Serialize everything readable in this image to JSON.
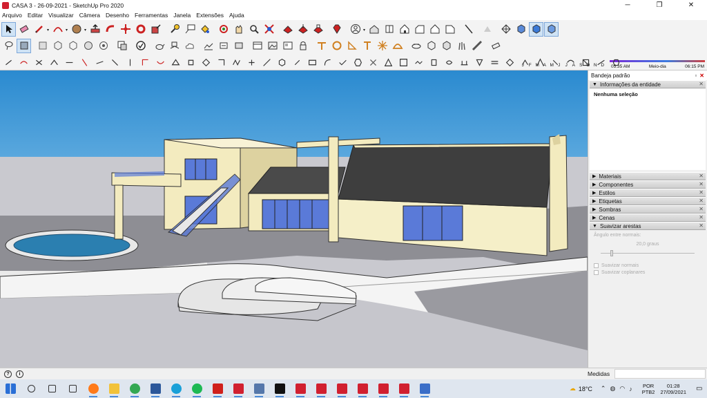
{
  "window": {
    "title": "CASA 3 - 26-09-2021 - SketchUp Pro 2020",
    "minimize": "─",
    "maximize": "❐",
    "close": "✕"
  },
  "menu": [
    "Arquivo",
    "Editar",
    "Visualizar",
    "Câmera",
    "Desenho",
    "Ferramentas",
    "Janela",
    "Extensões",
    "Ajuda"
  ],
  "shadow": {
    "months": [
      "J",
      "F",
      "M",
      "A",
      "M",
      "J",
      "J",
      "A",
      "S",
      "O",
      "N",
      "D"
    ],
    "time_start": "05:35 AM",
    "time_mid": "Meio-dia",
    "time_end": "06:15 PM"
  },
  "tray": {
    "title": "Bandeja padrão",
    "pin": "▫",
    "close": "✕",
    "entity_panel": {
      "label": "Informações da entidade",
      "value": "Nenhuma seleção"
    },
    "panels": [
      {
        "label": "Materiais",
        "arrow": "▶"
      },
      {
        "label": "Componentes",
        "arrow": "▶"
      },
      {
        "label": "Estilos",
        "arrow": "▶"
      },
      {
        "label": "Etiquetas",
        "arrow": "▶"
      },
      {
        "label": "Sombras",
        "arrow": "▶"
      },
      {
        "label": "Cenas",
        "arrow": "▶"
      },
      {
        "label": "Suavizar arestas",
        "arrow": "▼"
      }
    ],
    "smooth": {
      "angle_label": "Ângulo entre normais:",
      "angle_value": "20,0",
      "angle_unit": "graus",
      "smooth_normals": "Suavizar normais",
      "soften_coplanar": "Suavizar coplanares"
    }
  },
  "status": {
    "help_icon": "?",
    "info_icon": "i",
    "measurements_label": "Medidas",
    "measurements_value": ""
  },
  "taskbar": {
    "apps": [
      {
        "name": "start",
        "color": "#2a6fd6"
      },
      {
        "name": "search",
        "color": "#333333"
      },
      {
        "name": "task-view",
        "color": "#333333"
      },
      {
        "name": "widgets",
        "color": "#333333"
      },
      {
        "name": "firefox",
        "color": "#ff7a1a"
      },
      {
        "name": "file-explorer",
        "color": "#f2c23a"
      },
      {
        "name": "chrome",
        "color": "#34a853"
      },
      {
        "name": "word",
        "color": "#2b579a"
      },
      {
        "name": "edge",
        "color": "#1aa0d8"
      },
      {
        "name": "spotify",
        "color": "#1db954"
      },
      {
        "name": "acrobat",
        "color": "#d0201c"
      },
      {
        "name": "sketchup",
        "color": "#d12030"
      },
      {
        "name": "database-app",
        "color": "#5577aa"
      },
      {
        "name": "notion",
        "color": "#111111"
      },
      {
        "name": "sketchup-2",
        "color": "#d12030"
      },
      {
        "name": "sketchup-3",
        "color": "#d12030"
      },
      {
        "name": "sketchup-4",
        "color": "#d12030"
      },
      {
        "name": "sketchup-5",
        "color": "#d12030"
      },
      {
        "name": "sketchup-6",
        "color": "#d12030"
      },
      {
        "name": "sketchup-7",
        "color": "#d12030"
      },
      {
        "name": "layout-app",
        "color": "#3a6ec8"
      }
    ],
    "temperature": "18°C",
    "lang_top": "POR",
    "lang_bottom": "PTB2",
    "time": "01:28",
    "date": "27/09/2021"
  }
}
